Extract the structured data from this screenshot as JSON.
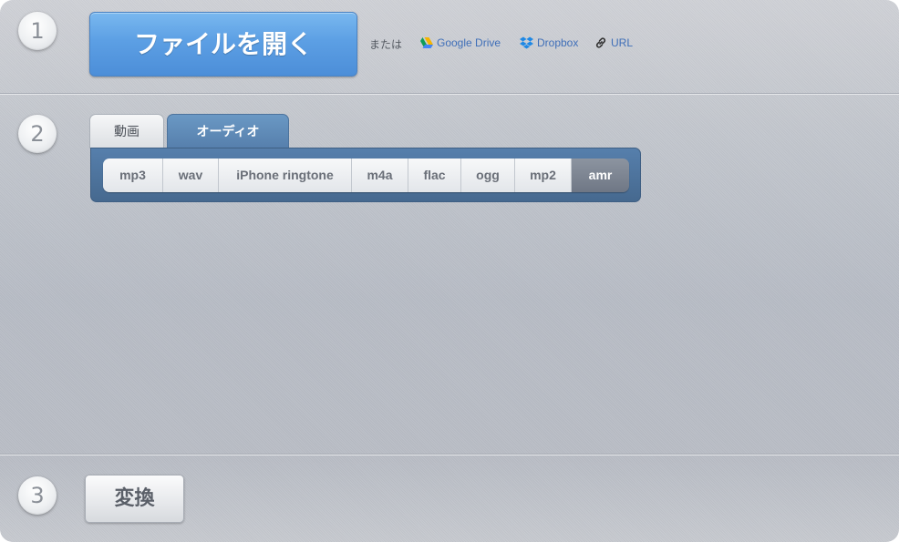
{
  "steps": [
    "1",
    "2",
    "3"
  ],
  "open_button": {
    "label": "ファイルを開く"
  },
  "sources": {
    "or_label": "または",
    "google_drive": "Google Drive",
    "dropbox": "Dropbox",
    "url": "URL"
  },
  "tabs": [
    {
      "label": "動画",
      "active": false
    },
    {
      "label": "オーディオ",
      "active": true
    }
  ],
  "formats": [
    {
      "label": "mp3",
      "selected": false
    },
    {
      "label": "wav",
      "selected": false
    },
    {
      "label": "iPhone ringtone",
      "selected": false
    },
    {
      "label": "m4a",
      "selected": false
    },
    {
      "label": "flac",
      "selected": false
    },
    {
      "label": "ogg",
      "selected": false
    },
    {
      "label": "mp2",
      "selected": false
    },
    {
      "label": "amr",
      "selected": true
    }
  ],
  "convert_button": {
    "label": "変換"
  },
  "colors": {
    "accent_blue": "#5c9fe4",
    "tab_active": "#567fac",
    "selected_format": "#6f7785",
    "link": "#3f6fb8"
  }
}
